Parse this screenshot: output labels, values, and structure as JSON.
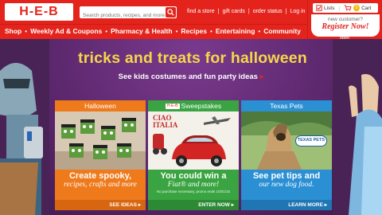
{
  "header": {
    "logo": "H-E-B",
    "search_placeholder": "Search products, recipes, and more",
    "links": [
      "find a store",
      "gift cards",
      "order status",
      "Log in"
    ]
  },
  "nav": {
    "items": [
      "Shop",
      "Weekly Ad & Coupons",
      "Pharmacy & Health",
      "Recipes",
      "Entertaining",
      "Community"
    ]
  },
  "cart": {
    "lists_label": "Lists",
    "cart_label": "Cart",
    "cart_count": "0",
    "promo_line": "new customer?",
    "promo_cta": "Register Now!",
    "open_label": "open"
  },
  "hero": {
    "headline": "tricks and treats for halloween",
    "subhead": "See kids costumes and fun party ideas",
    "subhead_arrow": "▸"
  },
  "cards": [
    {
      "title": "Halloween",
      "line1": "Create spooky,",
      "line2": "recipes, crafts and more",
      "fine": "",
      "cta": "SEE IDEAS ▸"
    },
    {
      "title": "Sweepstakes",
      "line1": "You could win a",
      "line2": "Fiat® and more!",
      "fine": "No purchase necessary, promo ends 10/31/15",
      "cta": "ENTER NOW ▸",
      "image_text": "CIAO ITALIA",
      "image_badge": "H-E-B"
    },
    {
      "title": "Texas Pets",
      "line1": "See pet tips and",
      "line2": "our new dog food.",
      "fine": "",
      "cta": "LEARN MORE ▸",
      "image_badge": "TEXAS PETS"
    }
  ],
  "colors": {
    "brand_red": "#e4241c",
    "hero_purple": "#5d2a6e",
    "headline_yellow": "#f5d64a",
    "orange": "#ee7a1c",
    "green": "#39a441",
    "blue": "#2a8fd3"
  }
}
